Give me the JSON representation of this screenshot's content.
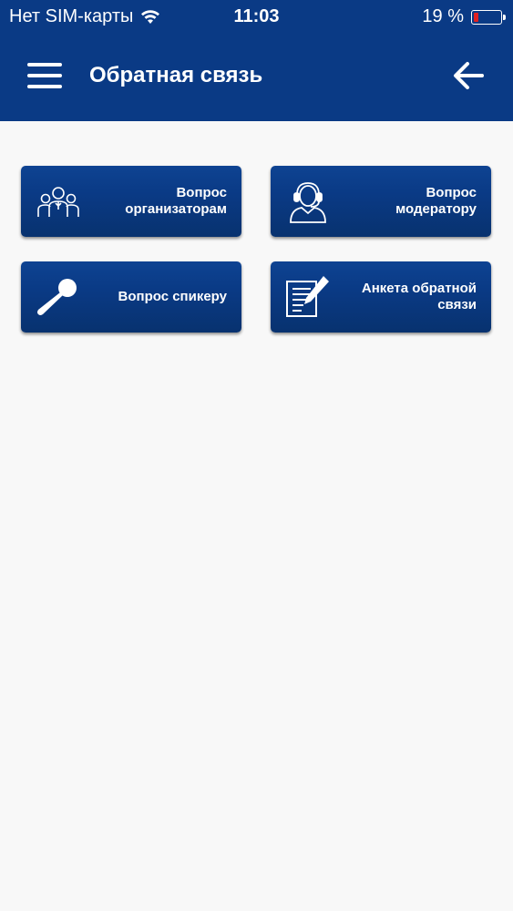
{
  "status_bar": {
    "carrier": "Нет SIM-карты",
    "time": "11:03",
    "battery_percent": "19 %",
    "battery_level": 0.19,
    "battery_color": "#e02020"
  },
  "header": {
    "title": "Обратная связь",
    "menu_icon": "hamburger-menu-icon",
    "back_icon": "arrow-left-icon",
    "background_color": "#0a3a85"
  },
  "tiles": [
    {
      "label": "Вопрос\nорганизаторам",
      "icon": "people-group-icon"
    },
    {
      "label": "Вопрос\nмодератору",
      "icon": "headset-operator-icon"
    },
    {
      "label": "Вопрос спикеру",
      "icon": "microphone-icon"
    },
    {
      "label": "Анкета обратной\nсвязи",
      "icon": "form-edit-icon"
    }
  ]
}
